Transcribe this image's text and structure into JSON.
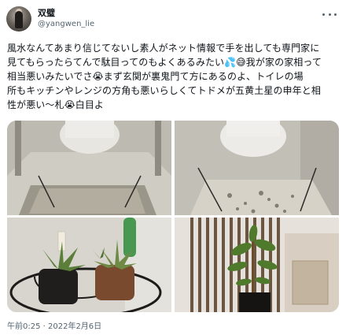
{
  "user": {
    "display_name": "双璧",
    "handle": "@yangwen_lie"
  },
  "tweet": {
    "lines": [
      "風水なんてあまり信じてないし素人がネット情報で手を出しても専門家に",
      "見てもらったらてんで駄目ってのもよくあるみたい💦😅我が家の家相って",
      "相当悪いみたいでさ😭まず玄関が裏鬼門て方にあるのよ、トイレの場",
      "所もキッチンやレンジの方角も悪いらしくてトドメが五黄土星の申年と相",
      "性が悪い〜札😭白目よ"
    ],
    "timestamp": "午前0:25 · 2022年2月6日"
  },
  "icons": {
    "more": "more-horizontal-icon"
  },
  "colors": {
    "text": "#0f1419",
    "secondary": "#536471",
    "background": "#ffffff"
  }
}
